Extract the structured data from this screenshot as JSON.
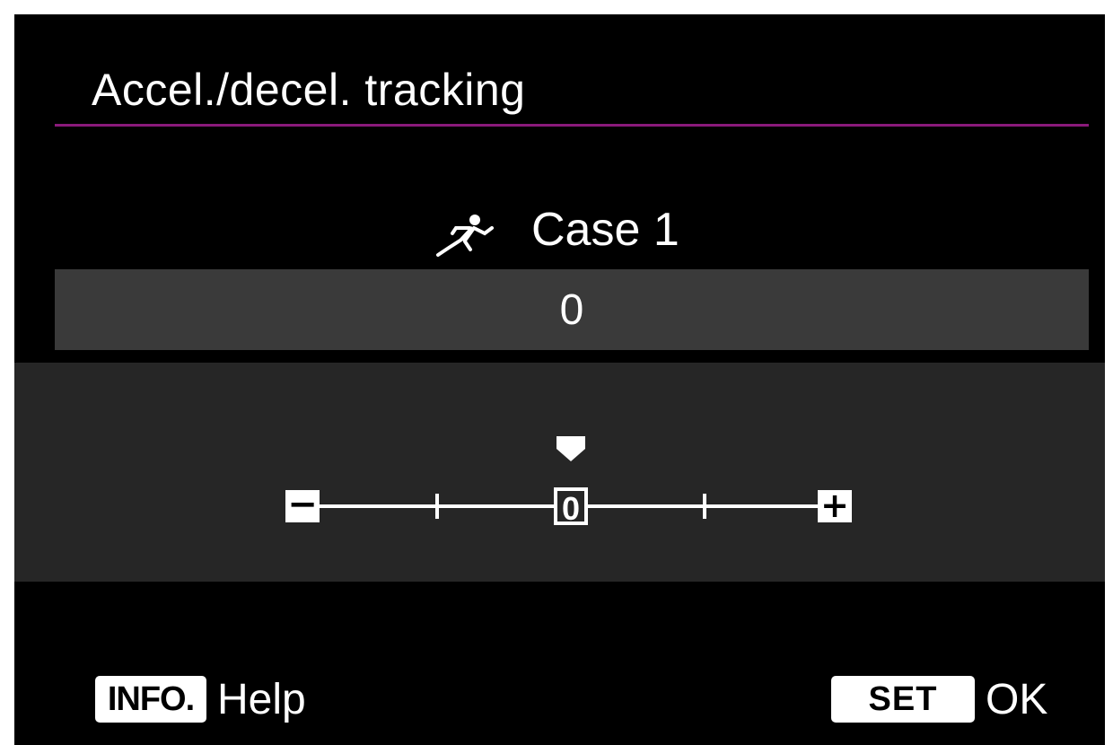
{
  "screen": {
    "title": "Accel./decel. tracking",
    "case_label": "Case 1",
    "case_icon": "athlete-running-icon",
    "current_value": "0"
  },
  "scale": {
    "min_symbol": "−",
    "max_symbol": "+",
    "center_label": "0",
    "min": -2,
    "max": 2,
    "value": 0,
    "step_count": 5
  },
  "footer": {
    "info_key": "INFO.",
    "info_action": "Help",
    "set_key": "SET",
    "set_action": "OK"
  },
  "colors": {
    "background": "#000000",
    "accent_rule": "#8a1a7a",
    "value_bar": "#3a3a3a",
    "scale_panel": "#262626"
  }
}
